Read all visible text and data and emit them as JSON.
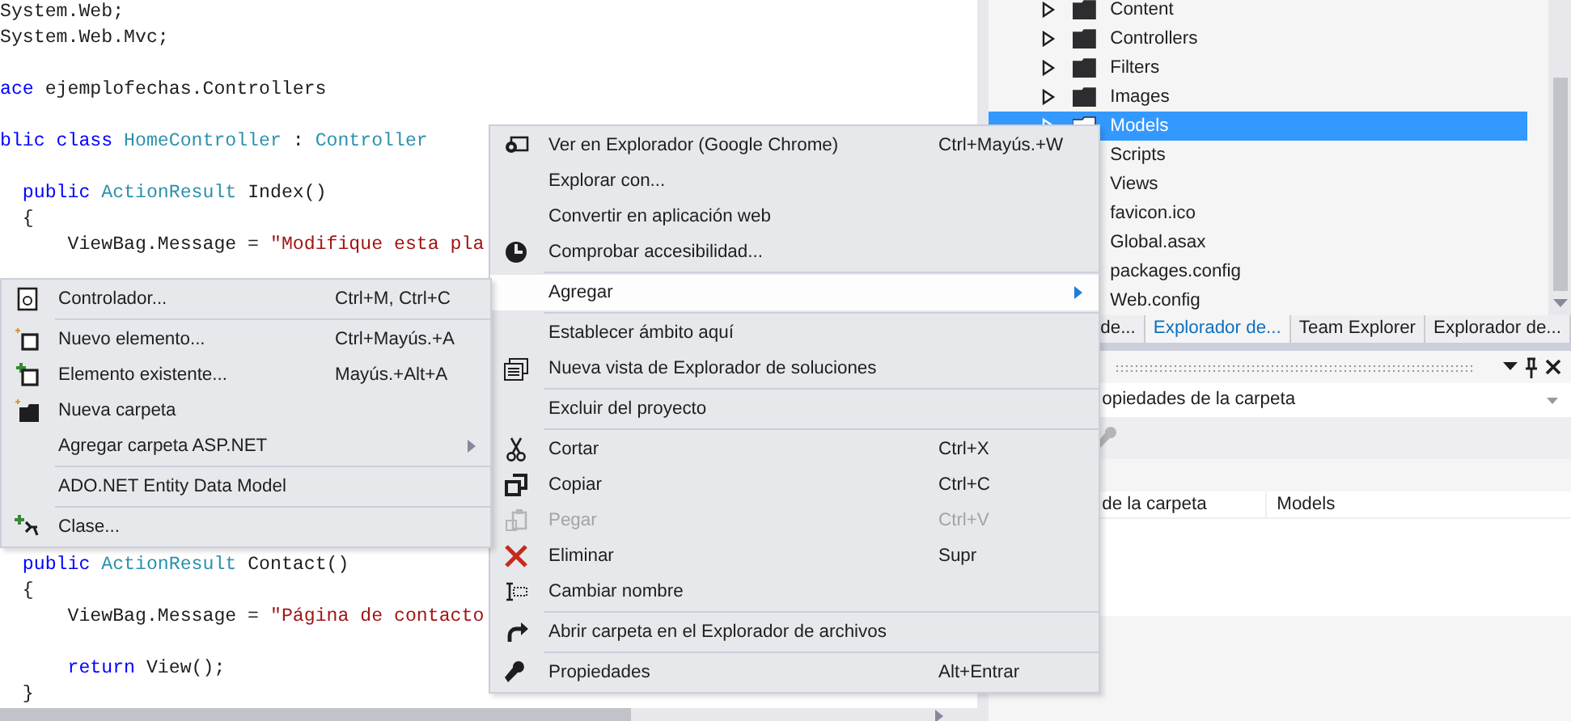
{
  "editor": {
    "code_top": [
      {
        "kind": "code",
        "tokens": [
          {
            "text": "System.Web;",
            "kind": "plain"
          }
        ]
      },
      {
        "kind": "code",
        "tokens": [
          {
            "text": "System.Web.Mvc;",
            "kind": "plain"
          }
        ]
      },
      {
        "kind": "blank"
      },
      {
        "kind": "code",
        "tokens": [
          {
            "text": "ace",
            "kind": "keyword"
          },
          {
            "text": " ejemplofechas.Controllers",
            "kind": "plain"
          }
        ]
      },
      {
        "kind": "blank"
      },
      {
        "kind": "code",
        "tokens": [
          {
            "text": "blic class ",
            "kind": "keyword"
          },
          {
            "text": "HomeController",
            "kind": "type"
          },
          {
            "text": " : ",
            "kind": "plain"
          },
          {
            "text": "Controller",
            "kind": "type"
          }
        ]
      },
      {
        "kind": "blank"
      },
      {
        "kind": "code",
        "tokens": [
          {
            "text": "  public ",
            "kind": "keyword"
          },
          {
            "text": "ActionResult",
            "kind": "type"
          },
          {
            "text": " Index()",
            "kind": "plain"
          }
        ]
      },
      {
        "kind": "code",
        "tokens": [
          {
            "text": "  {",
            "kind": "plain"
          }
        ]
      },
      {
        "kind": "code",
        "tokens": [
          {
            "text": "      ViewBag.Message = ",
            "kind": "plain"
          },
          {
            "text": "\"Modifique esta pla",
            "kind": "string"
          }
        ]
      }
    ],
    "code_bottom": [
      {
        "kind": "code",
        "tokens": [
          {
            "text": "  public ",
            "kind": "keyword"
          },
          {
            "text": "ActionResult",
            "kind": "type"
          },
          {
            "text": " Contact()",
            "kind": "plain"
          }
        ]
      },
      {
        "kind": "code",
        "tokens": [
          {
            "text": "  {",
            "kind": "plain"
          }
        ]
      },
      {
        "kind": "code",
        "tokens": [
          {
            "text": "      ViewBag.Message = ",
            "kind": "plain"
          },
          {
            "text": "\"Página de contacto",
            "kind": "string"
          }
        ]
      },
      {
        "kind": "blank"
      },
      {
        "kind": "code",
        "tokens": [
          {
            "text": "      return",
            "kind": "keyword"
          },
          {
            "text": " View();",
            "kind": "plain"
          }
        ]
      },
      {
        "kind": "code",
        "tokens": [
          {
            "text": "  }",
            "kind": "plain"
          }
        ]
      }
    ]
  },
  "solution_explorer": {
    "items": [
      {
        "label": "Content",
        "kind": "folder",
        "expander": true,
        "selected": false
      },
      {
        "label": "Controllers",
        "kind": "folder",
        "expander": true,
        "selected": false
      },
      {
        "label": "Filters",
        "kind": "folder",
        "expander": true,
        "selected": false
      },
      {
        "label": "Images",
        "kind": "folder",
        "expander": true,
        "selected": false
      },
      {
        "label": "Models",
        "kind": "folder",
        "expander": true,
        "selected": true
      },
      {
        "label": "Scripts",
        "kind": "file",
        "selected": false
      },
      {
        "label": "Views",
        "kind": "file",
        "selected": false
      },
      {
        "label": "favicon.ico",
        "kind": "file",
        "selected": false
      },
      {
        "label": "Global.asax",
        "kind": "file",
        "selected": false
      },
      {
        "label": "packages.config",
        "kind": "file",
        "selected": false
      },
      {
        "label": "Web.config",
        "kind": "file",
        "selected": false
      }
    ],
    "tabs": [
      {
        "label": "de...",
        "selected": false
      },
      {
        "label": "Explorador de...",
        "selected": true
      },
      {
        "label": "Team Explorer",
        "selected": false
      },
      {
        "label": "Explorador de...",
        "selected": false
      }
    ]
  },
  "properties": {
    "object": "opiedades de la carpeta",
    "rows": [
      {
        "name": "de la carpeta",
        "value": "Models"
      }
    ]
  },
  "context_menu": {
    "items": [
      {
        "kind": "item",
        "label": "Ver en Explorador (Google Chrome)",
        "shortcut": "Ctrl+Mayús.+W",
        "selected": false,
        "disabled": false,
        "has_submenu": false
      },
      {
        "kind": "item",
        "label": "Explorar con...",
        "selected": false,
        "disabled": false,
        "has_submenu": false
      },
      {
        "kind": "item",
        "label": "Convertir en aplicación web",
        "selected": false,
        "disabled": false,
        "has_submenu": false
      },
      {
        "kind": "item",
        "label": "Comprobar accesibilidad...",
        "selected": false,
        "disabled": false,
        "has_submenu": false
      },
      {
        "kind": "separator"
      },
      {
        "kind": "item",
        "label": "Agregar",
        "selected": true,
        "disabled": false,
        "has_submenu": true
      },
      {
        "kind": "separator"
      },
      {
        "kind": "item",
        "label": "Establecer ámbito aquí",
        "selected": false,
        "disabled": false,
        "has_submenu": false
      },
      {
        "kind": "item",
        "label": "Nueva vista de Explorador de soluciones",
        "selected": false,
        "disabled": false,
        "has_submenu": false
      },
      {
        "kind": "separator"
      },
      {
        "kind": "item",
        "label": "Excluir del proyecto",
        "selected": false,
        "disabled": false,
        "has_submenu": false
      },
      {
        "kind": "separator"
      },
      {
        "kind": "item",
        "label": "Cortar",
        "shortcut": "Ctrl+X",
        "selected": false,
        "disabled": false,
        "has_submenu": false
      },
      {
        "kind": "item",
        "label": "Copiar",
        "shortcut": "Ctrl+C",
        "selected": false,
        "disabled": false,
        "has_submenu": false
      },
      {
        "kind": "item",
        "label": "Pegar",
        "shortcut": "Ctrl+V",
        "selected": false,
        "disabled": true,
        "has_submenu": false
      },
      {
        "kind": "item",
        "label": "Eliminar",
        "shortcut": "Supr",
        "selected": false,
        "disabled": false,
        "has_submenu": false
      },
      {
        "kind": "item",
        "label": "Cambiar nombre",
        "selected": false,
        "disabled": false,
        "has_submenu": false
      },
      {
        "kind": "separator"
      },
      {
        "kind": "item",
        "label": "Abrir carpeta en el Explorador de archivos",
        "selected": false,
        "disabled": false,
        "has_submenu": false
      },
      {
        "kind": "separator"
      },
      {
        "kind": "item",
        "label": "Propiedades",
        "shortcut": "Alt+Entrar",
        "selected": false,
        "disabled": false,
        "has_submenu": false
      }
    ]
  },
  "submenu": {
    "items": [
      {
        "kind": "item",
        "label": "Controlador...",
        "shortcut": "Ctrl+M, Ctrl+C",
        "selected": false,
        "disabled": false,
        "has_submenu": false
      },
      {
        "kind": "separator"
      },
      {
        "kind": "item",
        "label": "Nuevo elemento...",
        "shortcut": "Ctrl+Mayús.+A",
        "selected": false,
        "disabled": false,
        "has_submenu": false
      },
      {
        "kind": "item",
        "label": "Elemento existente...",
        "shortcut": "Mayús.+Alt+A",
        "selected": false,
        "disabled": false,
        "has_submenu": false
      },
      {
        "kind": "item",
        "label": "Nueva carpeta",
        "selected": false,
        "disabled": false,
        "has_submenu": false
      },
      {
        "kind": "item",
        "label": "Agregar carpeta ASP.NET",
        "selected": false,
        "disabled": false,
        "has_submenu": true
      },
      {
        "kind": "separator"
      },
      {
        "kind": "item",
        "label": "ADO.NET Entity Data Model",
        "selected": false,
        "disabled": false,
        "has_submenu": false
      },
      {
        "kind": "separator"
      },
      {
        "kind": "item",
        "label": "Clase...",
        "selected": false,
        "disabled": false,
        "has_submenu": false
      }
    ]
  }
}
